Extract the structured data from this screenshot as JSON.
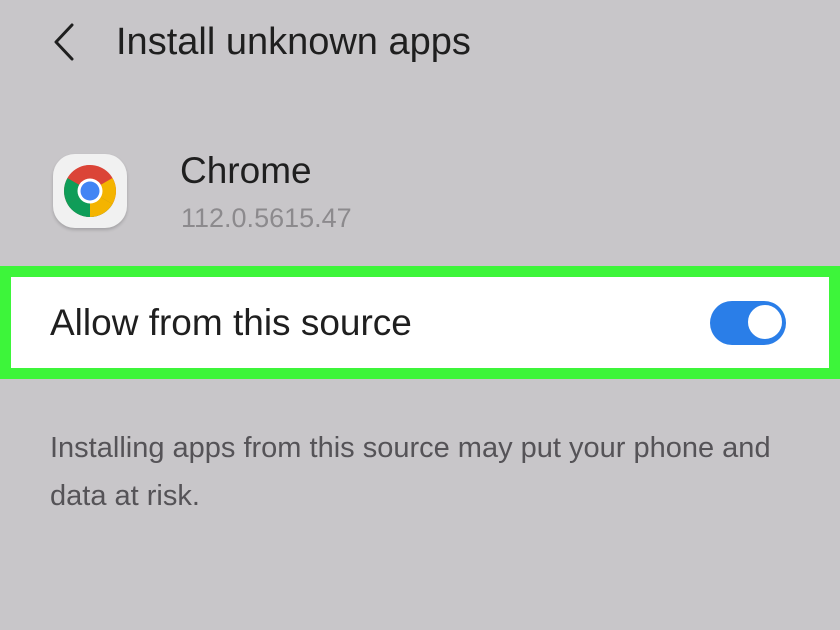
{
  "header": {
    "back_icon": "chevron-left-icon",
    "title": "Install unknown apps"
  },
  "app": {
    "icon": "chrome-icon",
    "name": "Chrome",
    "version": "112.0.5615.47"
  },
  "allow_setting": {
    "label": "Allow from this source",
    "enabled": true,
    "highlight_color": "#3df53a",
    "switch_color": "#2a7ee8"
  },
  "warning": {
    "text": "Installing apps from this source may put your phone and data at risk."
  }
}
